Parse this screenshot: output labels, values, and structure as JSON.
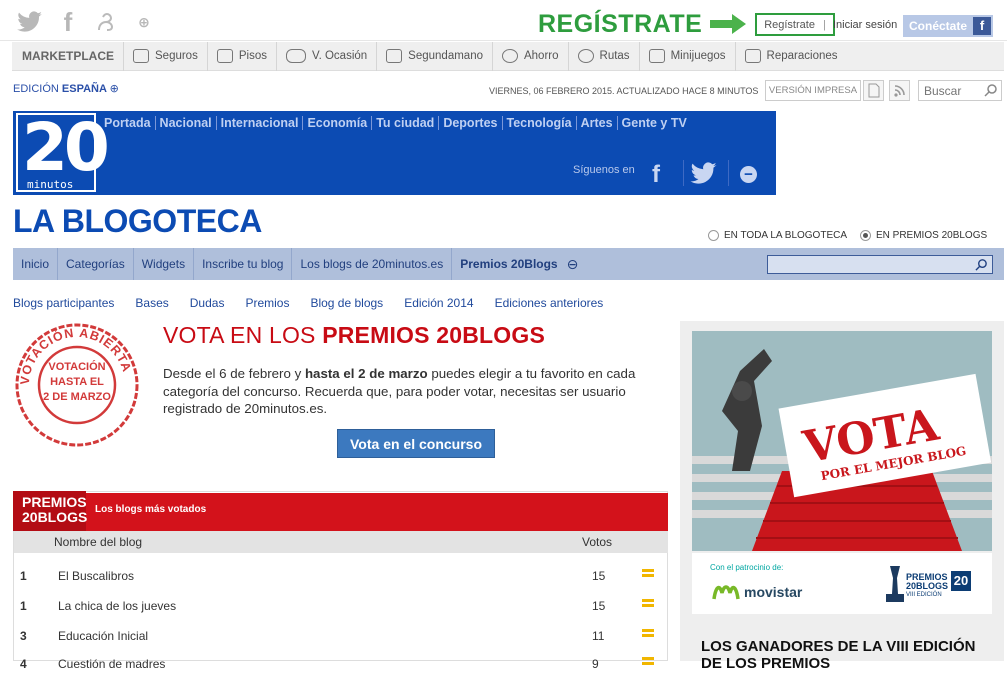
{
  "topbar": {
    "social_icons": [
      "twitter-icon",
      "facebook-icon",
      "tuenti-icon",
      "plus-icon"
    ],
    "register_callout": "REGÍSTRATE",
    "register_button": "Regístrate",
    "separator": "|",
    "login_label": "Iniciar sesión",
    "connect_label": "Conéctate",
    "facebook_glyph": "f"
  },
  "marketplace": {
    "title": "MARKETPLACE",
    "items": [
      "Seguros",
      "Pisos",
      "V. Ocasión",
      "Segundamano",
      "Ahorro",
      "Rutas",
      "Minijuegos",
      "Reparaciones"
    ]
  },
  "edition": {
    "prefix": "EDICIÓN",
    "country": "ESPAÑA",
    "toggle": "⊕",
    "dateline": "VIERNES, 06 FEBRERO 2015. ACTUALIZADO HACE 8 MINUTOS",
    "print_version": "VERSIÓN IMPRESA",
    "search_placeholder": "Buscar"
  },
  "header": {
    "logo_number": "20",
    "logo_word": "minutos",
    "nav": [
      "Portada",
      "Nacional",
      "Internacional",
      "Economía",
      "Tu ciudad",
      "Deportes",
      "Tecnología",
      "Artes",
      "Gente y TV"
    ],
    "follow_label": "Síguenos en"
  },
  "blogoteca": {
    "title": "LA BLOGOTECA",
    "scope_options": [
      {
        "label": "EN TODA LA BLOGOTECA",
        "selected": false
      },
      {
        "label": "EN PREMIOS 20BLOGS",
        "selected": true
      }
    ],
    "nav": [
      "Inicio",
      "Categorías",
      "Widgets",
      "Inscribe tu blog",
      "Los blogs de 20minutos.es",
      "Premios 20Blogs"
    ],
    "nav_toggle": "⊖",
    "subnav": [
      "Blogs participantes",
      "Bases",
      "Dudas",
      "Premios",
      "Blog de blogs",
      "Edición 2014",
      "Ediciones anteriores"
    ]
  },
  "stamp": {
    "outer_text": "VOTACIÓN ABIERTA",
    "line1": "VOTACIÓN",
    "line2": "HASTA EL",
    "line3": "2 DE MARZO"
  },
  "vote": {
    "heading_prefix": "VOTA EN LOS",
    "heading_bold": "PREMIOS 20BLOGS",
    "text_a": "Desde el 6 de febrero y",
    "text_b": "hasta el 2 de marzo",
    "text_c": "puedes elegir a tu favorito en cada categoría del concurso. Recuerda que, para poder votar, necesitas ser usuario registrado de 20minutos.es.",
    "button": "Vota en el concurso"
  },
  "ranking": {
    "logo_line1": "PREMIOS",
    "logo_line2": "20BLOGS",
    "subtitle": "Los blogs más votados",
    "col_name": "Nombre del blog",
    "col_votes": "Votos",
    "rows": [
      {
        "pos": "1",
        "name": "El Buscalibros",
        "votes": "15"
      },
      {
        "pos": "1",
        "name": "La chica de los jueves",
        "votes": "15"
      },
      {
        "pos": "3",
        "name": "Educación Inicial",
        "votes": "11"
      },
      {
        "pos": "4",
        "name": "Cuestión de madres",
        "votes": "9"
      }
    ]
  },
  "sidebar": {
    "poster_title": "VOTA",
    "poster_sub": "POR EL MEJOR BLOG",
    "sponsor_label": "Con el patrocinio de:",
    "sponsor": "movistar",
    "premios_line1": "PREMIOS",
    "premios_line2": "20BLOGS",
    "premios_line3": "VIII EDICIÓN",
    "winners_heading": "LOS GANADORES DE LA VIII EDICIÓN DE LOS PREMIOS"
  },
  "colors": {
    "brand_blue": "#0c4bb3",
    "register_green": "#2e9d3e",
    "premios_red": "#d3121b",
    "nav_bg": "#afbfdb"
  }
}
